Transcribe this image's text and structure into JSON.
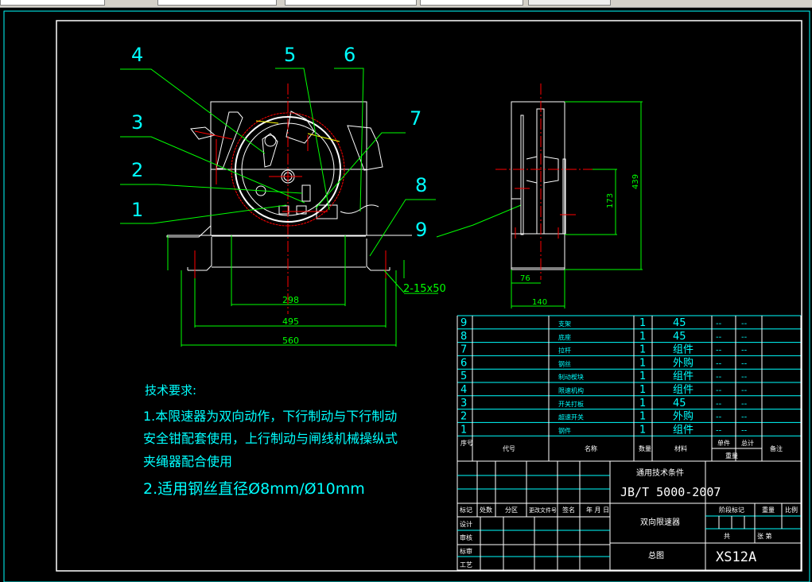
{
  "leaders": [
    "4",
    "5",
    "6",
    "3",
    "7",
    "2",
    "8",
    "1",
    "9"
  ],
  "dimensions": {
    "d298": "298",
    "d495": "495",
    "d560": "560",
    "holes": "2-15x50",
    "d173": "173",
    "d439": "439",
    "d76": "76",
    "d140": "140"
  },
  "notes": {
    "title": "技术要求:",
    "line1": "1.本限速器为双向动作，下行制动与下行制动",
    "line2": "安全钳配套使用，上行制动与闸线机械操纵式",
    "line3": "夹绳器配合使用",
    "line4": "2.适用钢丝直径Ø8mm/Ø10mm"
  },
  "bom": {
    "rows": [
      {
        "no": "9",
        "name": "支架",
        "qty": "1",
        "material": "45",
        "unit": "--",
        "total": "--"
      },
      {
        "no": "8",
        "name": "底座",
        "qty": "1",
        "material": "45",
        "unit": "--",
        "total": "--"
      },
      {
        "no": "7",
        "name": "拉杆",
        "qty": "1",
        "material": "组件",
        "unit": "--",
        "total": "--"
      },
      {
        "no": "6",
        "name": "钢丝",
        "qty": "1",
        "material": "外购",
        "unit": "--",
        "total": "--"
      },
      {
        "no": "5",
        "name": "制动楔块",
        "qty": "1",
        "material": "组件",
        "unit": "--",
        "total": "--"
      },
      {
        "no": "4",
        "name": "限速机构",
        "qty": "1",
        "material": "组件",
        "unit": "--",
        "total": "--"
      },
      {
        "no": "3",
        "name": "开关打板",
        "qty": "1",
        "material": "45",
        "unit": "--",
        "total": "--"
      },
      {
        "no": "2",
        "name": "超速开关",
        "qty": "1",
        "material": "外购",
        "unit": "--",
        "total": "--"
      },
      {
        "no": "1",
        "name": "钢件",
        "qty": "1",
        "material": "组件",
        "unit": "--",
        "total": "--"
      }
    ],
    "header": {
      "no": "序号",
      "code": "代号",
      "name": "名称",
      "qty": "数量",
      "material": "材料",
      "unit": "单件",
      "total": "总计",
      "weight": "重量",
      "remark": "备注"
    }
  },
  "title_block": {
    "standard_title": "通用技术条件",
    "standard": "JB/T 5000-2007",
    "labels": [
      "标记",
      "处数",
      "分区",
      "更改文件号",
      "签名",
      "年 月 日"
    ],
    "roles": [
      "设计",
      "审核",
      "标审",
      "工艺"
    ],
    "product_name": "双向限速器",
    "drawing_type": "总图",
    "drawing_no": "XS12A",
    "stage_label": "阶段标记",
    "weight_label": "重量",
    "scale_label": "比例",
    "sheets_label": "共",
    "sheet_label": "张 第"
  },
  "colors": {
    "frame": "#00ffff",
    "white": "#ffffff",
    "dim": "#00ff00",
    "center": "#ff0000",
    "text": "#00ffff",
    "yellow": "#ffff00",
    "blue": "#0000ff"
  }
}
